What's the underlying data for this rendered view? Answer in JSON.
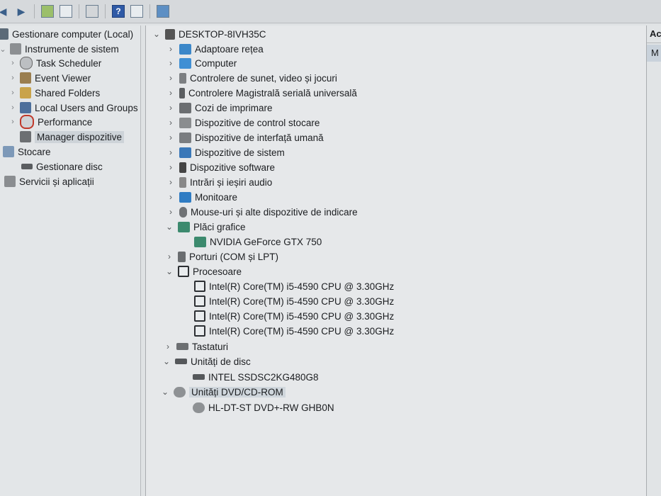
{
  "toolbar": {
    "buttons": [
      "back-icon",
      "forward-icon",
      "up-folder-icon",
      "show-hide-tree-icon",
      "properties-icon",
      "help-icon",
      "view-icon",
      "monitor-icon"
    ],
    "help_glyph": "?"
  },
  "nav": {
    "items": [
      {
        "label": "Gestionare computer (Local)",
        "icon": "computer-management-icon"
      },
      {
        "label": "Instrumente de sistem",
        "icon": "system-tools-icon"
      },
      {
        "label": "Task Scheduler",
        "icon": "task-scheduler-icon"
      },
      {
        "label": "Event Viewer",
        "icon": "event-viewer-icon"
      },
      {
        "label": "Shared Folders",
        "icon": "shared-folders-icon"
      },
      {
        "label": "Local Users and Groups",
        "icon": "users-icon"
      },
      {
        "label": "Performance",
        "icon": "performance-icon"
      },
      {
        "label": "Manager dispozitive",
        "icon": "device-manager-icon"
      },
      {
        "label": "Stocare",
        "icon": "storage-icon"
      },
      {
        "label": "Gestionare disc",
        "icon": "disk-management-icon"
      },
      {
        "label": "Servicii și aplicații",
        "icon": "services-icon"
      }
    ]
  },
  "tree": {
    "root": "DESKTOP-8IVH35C",
    "categories": [
      {
        "label": "Adaptoare rețea",
        "icon": "network-adapter-icon"
      },
      {
        "label": "Computer",
        "icon": "computer-icon"
      },
      {
        "label": "Controlere de sunet, video și jocuri",
        "icon": "sound-icon"
      },
      {
        "label": "Controlere Magistrală serială universală",
        "icon": "usb-icon"
      },
      {
        "label": "Cozi de imprimare",
        "icon": "printer-icon"
      },
      {
        "label": "Dispozitive de control stocare",
        "icon": "storage-controller-icon"
      },
      {
        "label": "Dispozitive de interfață umană",
        "icon": "hid-icon"
      },
      {
        "label": "Dispozitive de sistem",
        "icon": "system-device-icon"
      },
      {
        "label": "Dispozitive software",
        "icon": "software-device-icon"
      },
      {
        "label": "Intrări și ieșiri audio",
        "icon": "audio-io-icon"
      },
      {
        "label": "Monitoare",
        "icon": "monitor-icon"
      },
      {
        "label": "Mouse-uri și alte dispozitive de indicare",
        "icon": "mouse-icon"
      },
      {
        "label": "Plăci grafice",
        "icon": "display-adapter-icon"
      },
      {
        "label": "NVIDIA GeForce GTX 750",
        "icon": "display-adapter-icon"
      },
      {
        "label": "Porturi (COM și LPT)",
        "icon": "port-icon"
      },
      {
        "label": "Procesoare",
        "icon": "processor-icon"
      },
      {
        "label": "Intel(R) Core(TM) i5-4590 CPU @ 3.30GHz",
        "icon": "processor-icon"
      },
      {
        "label": "Intel(R) Core(TM) i5-4590 CPU @ 3.30GHz",
        "icon": "processor-icon"
      },
      {
        "label": "Intel(R) Core(TM) i5-4590 CPU @ 3.30GHz",
        "icon": "processor-icon"
      },
      {
        "label": "Intel(R) Core(TM) i5-4590 CPU @ 3.30GHz",
        "icon": "processor-icon"
      },
      {
        "label": "Tastaturi",
        "icon": "keyboard-icon"
      },
      {
        "label": "Unități de disc",
        "icon": "disk-drive-icon"
      },
      {
        "label": "INTEL SSDSC2KG480G8",
        "icon": "disk-drive-icon"
      },
      {
        "label": "Unități DVD/CD-ROM",
        "icon": "dvd-drive-icon"
      },
      {
        "label": "HL-DT-ST DVD+-RW GHB0N",
        "icon": "dvd-drive-icon"
      }
    ]
  },
  "actions": {
    "header": "Ac",
    "item": "M"
  },
  "glyphs": {
    "collapsed": "›",
    "expanded": "⌄",
    "back": "◀",
    "forward": "▶"
  }
}
